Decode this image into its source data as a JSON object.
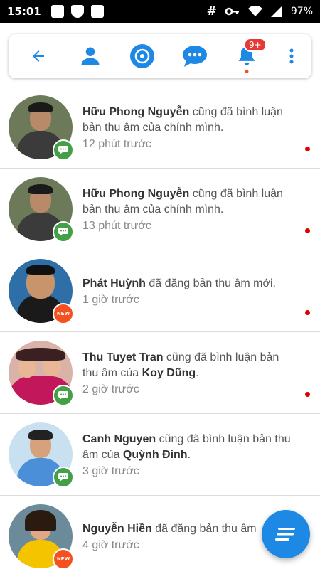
{
  "status_bar": {
    "time": "15:01",
    "battery": "97%"
  },
  "toolbar": {
    "notification_badge": "9+"
  },
  "notifications": [
    {
      "actor": "Hữu Phong Nguyễn",
      "action": " cũng đã bình luận bản thu âm của chính mình.",
      "target": "",
      "suffix": "",
      "time": "12 phút trước",
      "type": "comment",
      "unread": true
    },
    {
      "actor": "Hữu Phong Nguyễn",
      "action": " cũng đã bình luận bản thu âm của chính mình.",
      "target": "",
      "suffix": "",
      "time": "13 phút trước",
      "type": "comment",
      "unread": true
    },
    {
      "actor": "Phát Huỳnh",
      "action": " đã đăng bản thu âm mới.",
      "target": "",
      "suffix": "",
      "time": "1 giờ trước",
      "type": "new",
      "unread": true
    },
    {
      "actor": "Thu Tuyet Tran",
      "action": " cũng đã bình luận bản thu âm của ",
      "target": "Koy Dũng",
      "suffix": ".",
      "time": "2 giờ trước",
      "type": "comment",
      "unread": true
    },
    {
      "actor": "Canh Nguyen",
      "action": " cũng đã bình luận bản thu âm của ",
      "target": "Quỳnh Đinh",
      "suffix": ".",
      "time": "3 giờ trước",
      "type": "comment",
      "unread": false
    },
    {
      "actor": "Nguyễn Hiền",
      "action": " đã đăng bản thu âm",
      "target": "",
      "suffix": "",
      "time": "4 giờ trước",
      "type": "new",
      "unread": false
    }
  ],
  "new_badge_label": "NEW",
  "colors": {
    "accent": "#1e88e5",
    "comment": "#43a047",
    "new": "#f4511e",
    "unread": "#e00000"
  }
}
